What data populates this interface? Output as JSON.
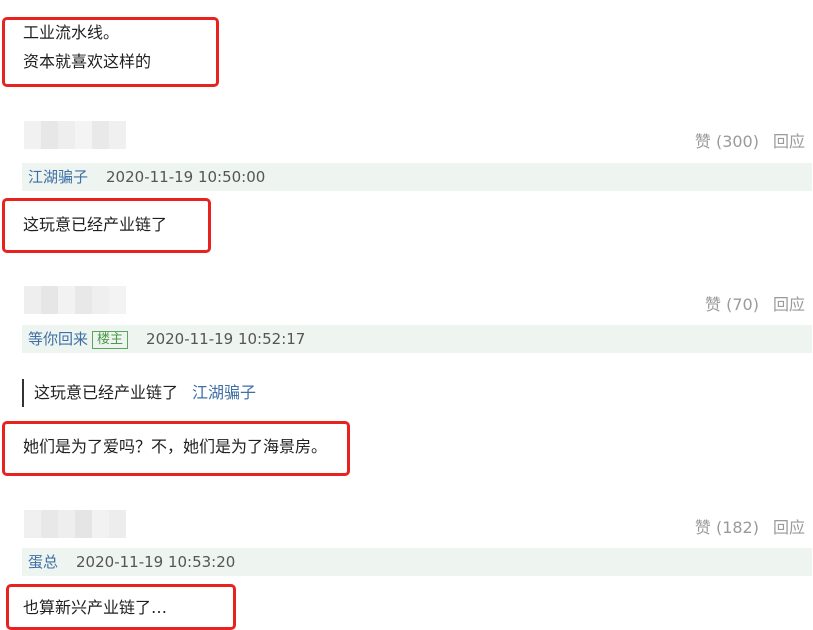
{
  "top_comment": {
    "lines": [
      "工业流水线。",
      "资本就喜欢这样的"
    ]
  },
  "comments": [
    {
      "likes_label": "赞 (300)",
      "reply_label": "回应",
      "username": "江湖骗子",
      "is_op": false,
      "timestamp": "2020-11-19 10:50:00",
      "text": "这玩意已经产业链了"
    },
    {
      "likes_label": "赞 (70)",
      "reply_label": "回应",
      "username": "等你回来",
      "is_op": true,
      "op_badge": "楼主",
      "timestamp": "2020-11-19 10:52:17",
      "quote": {
        "text": "这玩意已经产业链了",
        "user": "江湖骗子"
      },
      "text": "她们是为了爱吗？不，她们是为了海景房。"
    },
    {
      "likes_label": "赞 (182)",
      "reply_label": "回应",
      "username": "蛋总",
      "is_op": false,
      "timestamp": "2020-11-19 10:53:20",
      "text": "也算新兴产业链了…"
    }
  ],
  "colors": {
    "highlight_box": "#e8231f",
    "username_link": "#3e6fa7",
    "meta_bar_bg": "#eef4ef",
    "op_badge": "#4d9a4d",
    "muted": "#9a9a9a"
  }
}
